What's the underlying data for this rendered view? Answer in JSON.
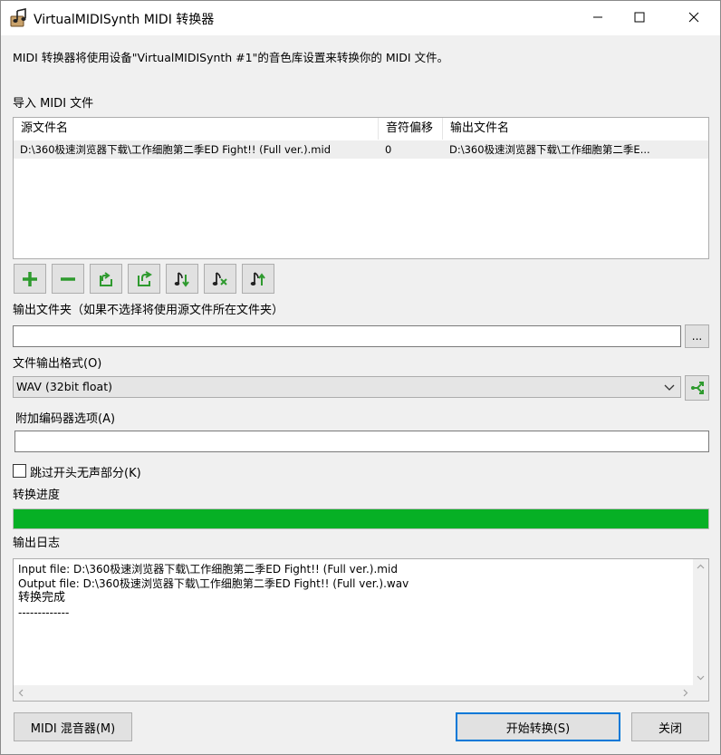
{
  "window": {
    "title": "VirtualMIDISynth MIDI 转换器",
    "icon": "music-note-app-icon"
  },
  "intro_text": "MIDI 转换器将使用设备\"VirtualMIDISynth #1\"的音色库设置来转换你的 MIDI 文件。",
  "import": {
    "label": "导入 MIDI 文件",
    "columns": [
      "源文件名",
      "音符偏移",
      "输出文件名"
    ],
    "rows": [
      {
        "source": "D:\\360极速浏览器下载\\工作细胞第二季ED Fight!! (Full ver.).mid",
        "offset": "0",
        "output": "D:\\360极速浏览器下载\\工作细胞第二季E..."
      }
    ],
    "toolbar": [
      "add-icon",
      "remove-icon",
      "import-icon",
      "export-icon",
      "note-down-icon",
      "note-delete-icon",
      "note-up-icon"
    ]
  },
  "output_folder": {
    "label": "输出文件夹（如果不选择将使用源文件所在文件夹）",
    "value": "",
    "browse_label": "..."
  },
  "format": {
    "label": "文件输出格式(O)",
    "selected": "WAV (32bit float)"
  },
  "encoder": {
    "label": "附加编码器选项(A)",
    "value": ""
  },
  "skip_silence": {
    "label": "跳过开头无声部分(K)",
    "checked": false
  },
  "progress": {
    "label": "转换进度",
    "fraction": 1.0,
    "color": "#06b025"
  },
  "log": {
    "label": "输出日志",
    "lines": [
      "Input file: D:\\360极速浏览器下载\\工作细胞第二季ED Fight!! (Full ver.).mid",
      "Output file: D:\\360极速浏览器下载\\工作细胞第二季ED Fight!! (Full ver.).wav",
      "转换完成",
      "-------------"
    ]
  },
  "buttons": {
    "mixer": "MIDI 混音器(M)",
    "start": "开始转换(S)",
    "close": "关闭"
  }
}
